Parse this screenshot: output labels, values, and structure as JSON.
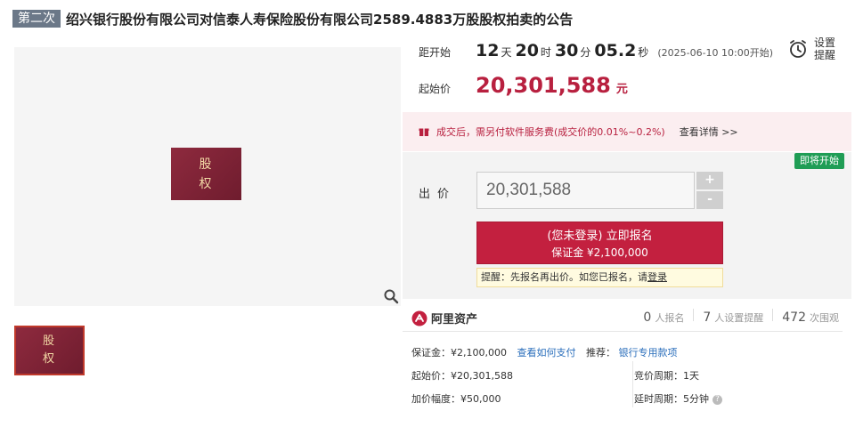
{
  "title": {
    "round_badge": "第二次",
    "text": "绍兴银行股份有限公司对信泰人寿保险股份有限公司2589.4883万股股权拍卖的公告"
  },
  "gallery": {
    "stamp_line1": "股",
    "stamp_line2": "权",
    "thumb_line1": "股",
    "thumb_line2": "权",
    "zoom_icon": "magnifier-icon"
  },
  "countdown": {
    "label": "距开始",
    "days": "12",
    "days_unit": "天",
    "hours": "20",
    "hours_unit": "时",
    "minutes": "30",
    "minutes_unit": "分",
    "seconds": "05.2",
    "seconds_unit": "秒",
    "start_time": "(2025-06-10 10:00开始)"
  },
  "alarm": {
    "line1": "设置",
    "line2": "提醒",
    "icon": "alarm-clock-icon"
  },
  "start_price": {
    "label": "起始价",
    "value": "20,301,588",
    "unit": "元"
  },
  "notice": {
    "text": "成交后，需另付软件服务费(成交价的0.01%~0.2%)",
    "link": "查看详情 >>",
    "icon": "gift-icon"
  },
  "bid": {
    "tag": "即将开始",
    "label": "出价",
    "input_value": "20,301,588",
    "plus": "+",
    "minus": "-",
    "signup_main": "(您未登录) 立即报名",
    "signup_sub": "保证金 ¥2,100,000",
    "reminder_text": "提醒：先报名再出价。如您已报名，请",
    "reminder_link": "登录"
  },
  "info": {
    "brand_name": "阿里资产",
    "brand_icon": "ali-asset-logo-icon",
    "stats": [
      {
        "num": "0",
        "label": "人报名"
      },
      {
        "num": "7",
        "label": "人设置提醒"
      },
      {
        "num": "472",
        "label": "次围观"
      }
    ],
    "deposit": "保证金：¥2,100,000",
    "deposit_link": "查看如何支付",
    "recommend_label": "推荐：",
    "recommend_link": "银行专用款项",
    "start_price": "起始价：¥20,301,588",
    "cycle": "竞价周期：1天",
    "increment": "加价幅度：¥50,000",
    "delay": "延时周期：5分钟",
    "help_icon": "question-icon"
  },
  "colors": {
    "accent": "#b8203f",
    "button": "#c3203f",
    "tag_green": "#1f9d55",
    "link": "#2a6ebb"
  }
}
